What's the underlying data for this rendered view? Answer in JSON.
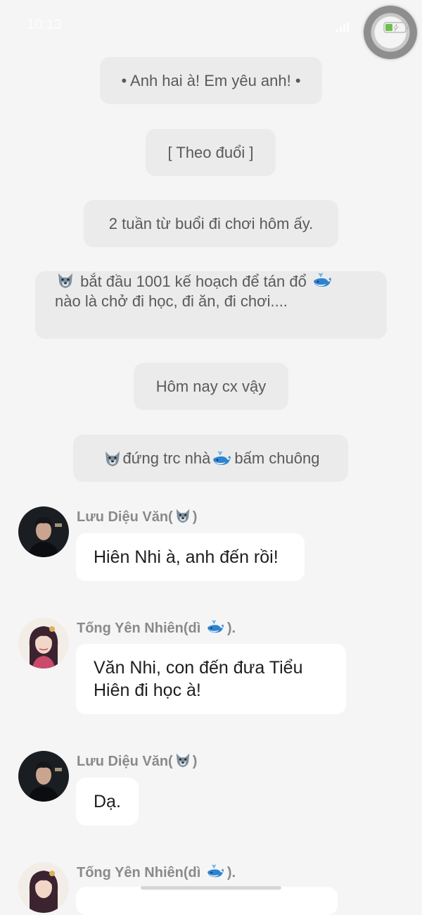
{
  "status_bar": {
    "time": "10:13"
  },
  "narrations": [
    {
      "text": "• Anh hai à! Em yêu anh! •"
    },
    {
      "text": "[ Theo đuổi ]"
    },
    {
      "text": "2 tuần từ buổi đi chơi hôm ấy."
    },
    {
      "line1_pre": "",
      "line1_mid": " bắt đầu 1001 kế hoạch để tán đổ ",
      "line2": "nào là chở đi học, đi ăn, đi chơi...."
    },
    {
      "text": "Hôm nay cx vậy"
    },
    {
      "part1": " đứng trc nhà ",
      "part2": " bấm chuông"
    }
  ],
  "messages": [
    {
      "sender": "Lưu Diệu Văn(",
      "sender_suffix": ")",
      "sender_icon": "wolf-icon",
      "text": "Hiên Nhi à, anh đến rồi!"
    },
    {
      "sender": "Tống Yên Nhiên(dì ",
      "sender_suffix": ").",
      "sender_icon": "whale-icon",
      "text": "Văn Nhi, con đến đưa Tiểu Hiên đi học à!"
    },
    {
      "sender": "Lưu Diệu Văn(",
      "sender_suffix": ")",
      "sender_icon": "wolf-icon",
      "text": "Dạ."
    },
    {
      "sender": "Tống Yên Nhiên(dì ",
      "sender_suffix": ").",
      "sender_icon": "whale-icon",
      "text": ""
    }
  ],
  "colors": {
    "background": "#f5f5f5",
    "narration_bg": "#ebebeb",
    "bubble_bg": "#ffffff",
    "sender_text": "#8a8a8a",
    "whale": "#3b8ed6",
    "wolf": "#6b7c8a"
  }
}
